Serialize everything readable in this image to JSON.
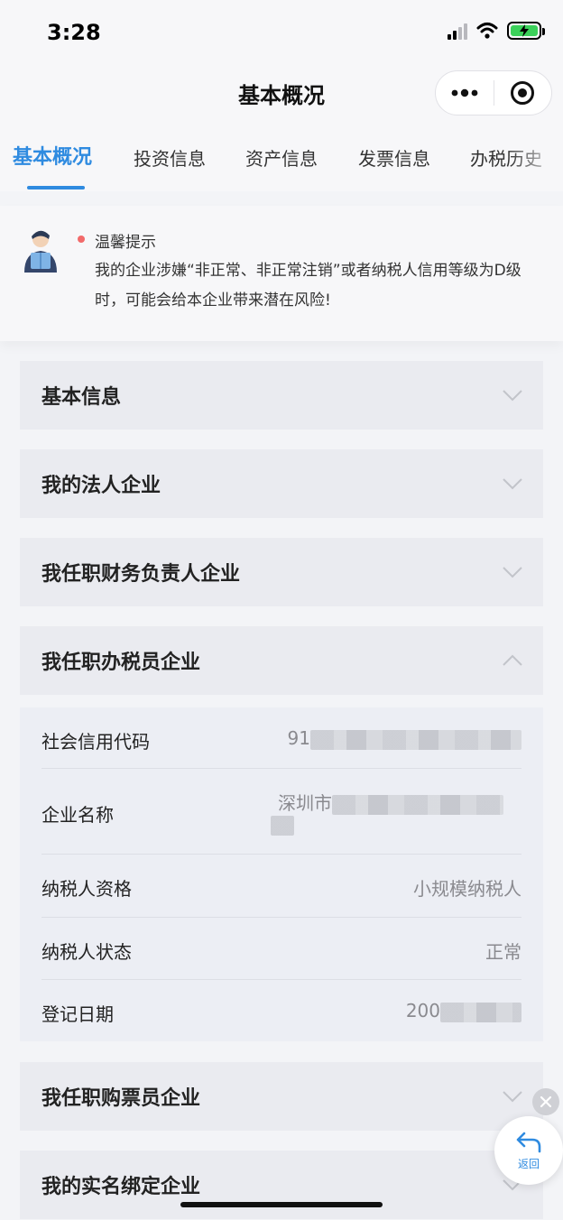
{
  "status_bar": {
    "time": "3:28"
  },
  "nav": {
    "title": "基本概况"
  },
  "tabs": [
    {
      "label": "基本概况",
      "active": true
    },
    {
      "label": "投资信息",
      "active": false
    },
    {
      "label": "资产信息",
      "active": false
    },
    {
      "label": "发票信息",
      "active": false
    },
    {
      "label": "办税历史",
      "active": false
    }
  ],
  "tip": {
    "title": "温馨提示",
    "text": "我的企业涉嫌“非正常、非正常注销”或者纳税人信用等级为D级时，可能会给本企业带来潜在风险!"
  },
  "sections": [
    {
      "title": "基本信息",
      "expanded": false
    },
    {
      "title": "我的法人企业",
      "expanded": false
    },
    {
      "title": "我任职财务负责人企业",
      "expanded": false
    },
    {
      "title": "我任职办税员企业",
      "expanded": true
    },
    {
      "title": "我任职购票员企业",
      "expanded": false
    },
    {
      "title": "我的实名绑定企业",
      "expanded": false
    }
  ],
  "detail_rows": [
    {
      "label": "社会信用代码",
      "value": "91"
    },
    {
      "label": "企业名称",
      "value": "深圳市"
    },
    {
      "label": "纳税人资格",
      "value": "小规模纳税人"
    },
    {
      "label": "纳税人状态",
      "value": "正常"
    },
    {
      "label": "登记日期",
      "value": "200"
    }
  ],
  "floating": {
    "back_label": "返回"
  },
  "colors": {
    "accent": "#2f8be0",
    "tip_dot": "#f26a6a",
    "battery": "#3bd15a"
  }
}
